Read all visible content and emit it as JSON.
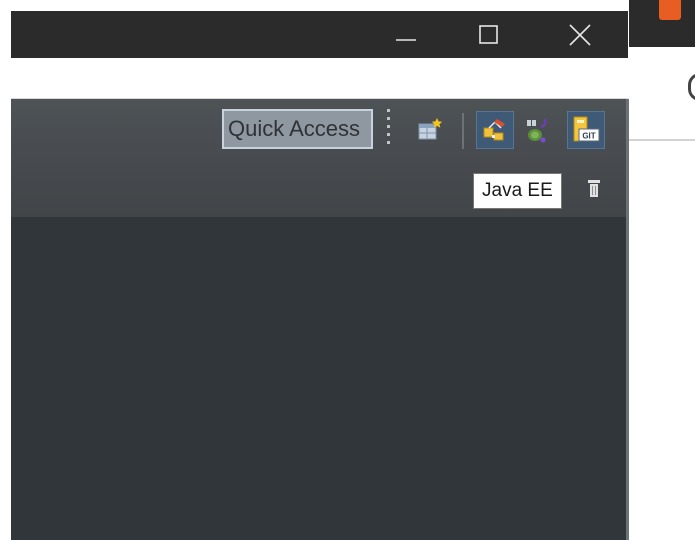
{
  "window": {
    "controls": {
      "minimize_icon": "minimize-icon",
      "maximize_icon": "maximize-icon",
      "close_icon": "close-icon"
    }
  },
  "toolbar": {
    "quick_access": {
      "placeholder": "Quick Access"
    },
    "buttons": [
      {
        "icon": "open-perspective-icon"
      },
      {
        "icon": "perspective-icon",
        "selected": true
      },
      {
        "icon": "debug-perspective-icon",
        "selected": false
      },
      {
        "icon": "git-perspective-icon",
        "selected": true,
        "badge": "GIT"
      }
    ]
  },
  "tooltip": {
    "text": "Java EE"
  },
  "colors": {
    "title_bar": "#2b2b2b",
    "toolbar": "#484c50",
    "editor": "#31363a",
    "selection": "#3e5a76",
    "app_accent": "#e85d22"
  }
}
